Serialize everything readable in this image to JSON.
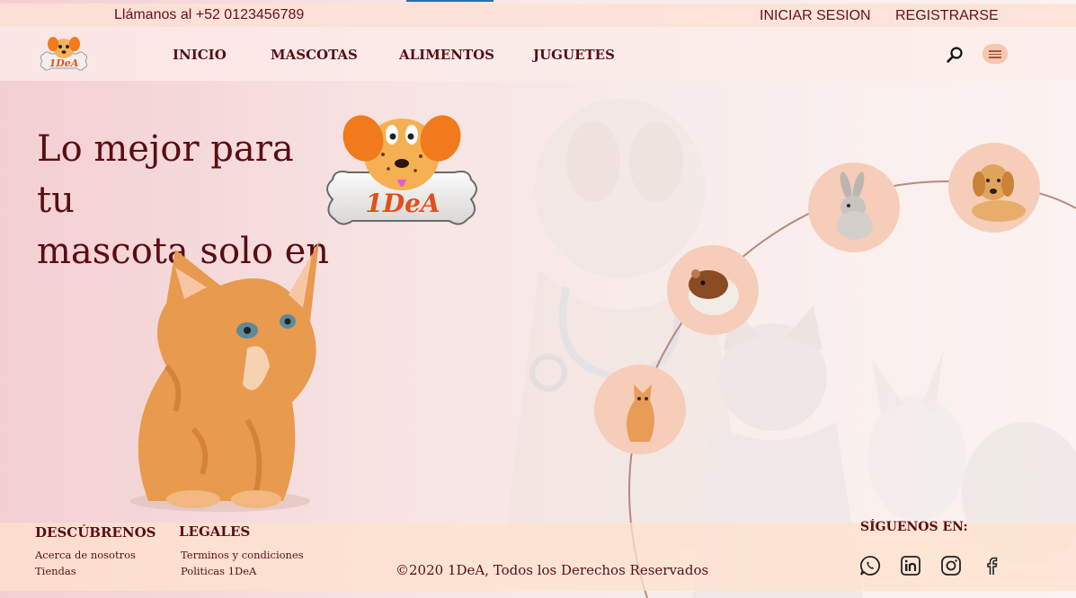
{
  "topbar": {
    "phone": "Llámanos al +52 0123456789",
    "login": "INICIAR SESION",
    "register": "REGISTRARSE"
  },
  "brand": {
    "logo_text": "1DeA"
  },
  "nav": {
    "items": [
      "INICIO",
      "MASCOTAS",
      "ALIMENTOS",
      "JUGUETES"
    ],
    "search_icon": "search-icon",
    "menu_icon": "hamburger-menu-icon"
  },
  "hero": {
    "title_line1": "Lo mejor para tu",
    "title_line2": "mascota solo en"
  },
  "pets": [
    "kitten",
    "hamster",
    "rabbit",
    "dog"
  ],
  "footer": {
    "discover_title": "DESCÚBRENOS",
    "discover_links": [
      "Acerca de nosotros",
      "Tiendas"
    ],
    "legal_title": "LEGALES",
    "legal_links": [
      "Terminos y condiciones",
      "Politicas 1DeA"
    ],
    "copyright": "2020 1DeA, Todos los Derechos Reservados",
    "follow_title": "SÍGUENOS EN:",
    "social": [
      "whatsapp-icon",
      "linkedin-icon",
      "instagram-icon",
      "facebook-icon"
    ]
  },
  "colors": {
    "brand_maroon": "#5a0d14",
    "accent_peach": "#f5cdb9",
    "logo_orange": "#f08a24"
  }
}
